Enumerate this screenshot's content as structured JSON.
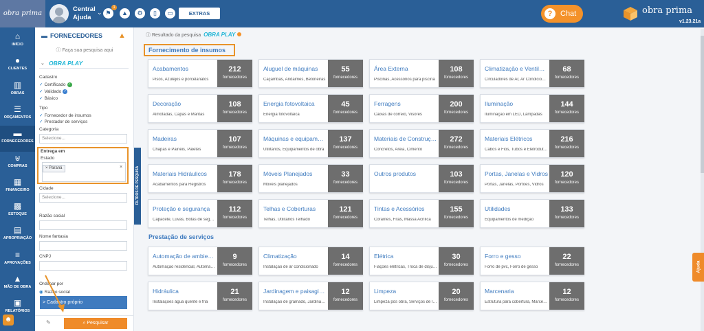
{
  "header": {
    "logo_text": "obra prima",
    "user_line1": "Central",
    "user_line2": "Ajuda",
    "notification_count": "1",
    "extras_label": "EXTRAS",
    "chat_label": "Chat",
    "brand": "obra prima",
    "version": "v1.23.21a"
  },
  "nav": [
    {
      "label": "INÍCIO",
      "icon": "home-icon",
      "glyph": "⌂"
    },
    {
      "label": "CLIENTES",
      "icon": "user-icon",
      "glyph": "●"
    },
    {
      "label": "OBRAS",
      "icon": "building-icon",
      "glyph": "▥"
    },
    {
      "label": "ORÇAMENTOS",
      "icon": "list-icon",
      "glyph": "☰"
    },
    {
      "label": "FORNECEDORES",
      "icon": "truck-icon",
      "glyph": "▬"
    },
    {
      "label": "COMPRAS",
      "icon": "cart-icon",
      "glyph": "⊎"
    },
    {
      "label": "FINANCEIRO",
      "icon": "calculator-icon",
      "glyph": "▦"
    },
    {
      "label": "ESTOQUE",
      "icon": "boxes-icon",
      "glyph": "▩"
    },
    {
      "label": "APROPRIAÇÃO",
      "icon": "clipboard-icon",
      "glyph": "▤"
    },
    {
      "label": "APROVAÇÕES",
      "icon": "checklist-icon",
      "glyph": "≡"
    },
    {
      "label": "MÃO DE OBRA",
      "icon": "workers-icon",
      "glyph": "▲"
    },
    {
      "label": "RELATÓRIOS",
      "icon": "report-icon",
      "glyph": "▣"
    }
  ],
  "filter": {
    "title": "FORNECEDORES",
    "search_hint": "Faça sua pesquisa aqui",
    "play_label": "OBRA PLAY",
    "cadastro_label": "Cadastro",
    "cadastro_options": [
      "Certificado",
      "Validado",
      "Básico"
    ],
    "tipo_label": "Tipo",
    "tipo_options": [
      "Fornecedor de insumos",
      "Prestador de serviços"
    ],
    "categoria_label": "Categoria",
    "categoria_placeholder": "Selecione...",
    "entrega_label": "Entrega em",
    "estado_label": "Estado",
    "estado_value": "× Paraná",
    "cidade_label": "Cidade",
    "cidade_placeholder": "Selecione...",
    "razao_label": "Razão social",
    "fantasia_label": "Nome fantasia",
    "cnpj_label": "CNPJ",
    "ordenar_label": "Ordenar por",
    "ordenar_option": "Razão social",
    "cadastro_proprio": "> Cadastro próprio",
    "tab_label": "FILTROS DE PESQUISA",
    "search_button": "Pesquisar"
  },
  "main": {
    "result_label": "Resultado da pesquisa",
    "play_label": "OBRA PLAY",
    "insumos_title": "Fornecimento de insumos",
    "servicos_title": "Prestação de serviços",
    "unit": "fornecedores",
    "insumos": [
      {
        "name": "Acabamentos",
        "desc": "Pisos, Azulejos e porcelanatos",
        "count": "212"
      },
      {
        "name": "Aluguel de máquinas",
        "desc": "Caçambas, Andaimes, Betoneiras",
        "count": "55"
      },
      {
        "name": "Área Externa",
        "desc": "Piscinas, Acessórios para piscina",
        "count": "108"
      },
      {
        "name": "Climatização e Ventilação",
        "desc": "Circuladores de Ar, Ar Condicionado",
        "count": "68"
      },
      {
        "name": "Decoração",
        "desc": "Almofadas, Capas e Mantas",
        "count": "108"
      },
      {
        "name": "Energia fotovoltaica",
        "desc": "Energia fotovoltaica",
        "count": "45"
      },
      {
        "name": "Ferragens",
        "desc": "Caixas de correio, Visores",
        "count": "200"
      },
      {
        "name": "Iluminação",
        "desc": "Iluminação em LED, Lâmpadas",
        "count": "144"
      },
      {
        "name": "Madeiras",
        "desc": "Chapas e Painéis, Paletes",
        "count": "107"
      },
      {
        "name": "Máquinas e equipamentos",
        "desc": "Utilitários, Equipamentos de obra",
        "count": "137"
      },
      {
        "name": "Materiais de Construção",
        "desc": "Concretos, Areia, Cimento",
        "count": "272"
      },
      {
        "name": "Materiais Elétricos",
        "desc": "Cabos e Fios, Tubos e Eletrodutos",
        "count": "216"
      },
      {
        "name": "Materiais Hidráulicos",
        "desc": "Acabamentos para Registros",
        "count": "178"
      },
      {
        "name": "Móveis Planejados",
        "desc": "Móveis planejados",
        "count": "33"
      },
      {
        "name": "Outros produtos",
        "desc": "",
        "count": "103"
      },
      {
        "name": "Portas, Janelas e Vidros",
        "desc": "Portas, Janelas, Portões, Vidros",
        "count": "120"
      },
      {
        "name": "Proteção e segurança",
        "desc": "Capacete, Luvas, Botas de segurança",
        "count": "112"
      },
      {
        "name": "Telhas e Coberturas",
        "desc": "Telhas, Utilitários Telhado",
        "count": "121"
      },
      {
        "name": "Tintas e Acessórios",
        "desc": "Corantes, Fitas, Massa Acrílica",
        "count": "155"
      },
      {
        "name": "Utilidades",
        "desc": "Equipamentos de medição",
        "count": "133"
      }
    ],
    "servicos": [
      {
        "name": "Automação de ambientes",
        "desc": "Automação residencial, Automação",
        "count": "9"
      },
      {
        "name": "Climatização",
        "desc": "Instalação de ar condicionado",
        "count": "14"
      },
      {
        "name": "Elétrica",
        "desc": "Fiações elétricas, Troca de disjuntor",
        "count": "30"
      },
      {
        "name": "Forro e gesso",
        "desc": "Forro de pvc, Forro de gesso",
        "count": "22"
      },
      {
        "name": "Hidráulica",
        "desc": "Instalações água quente e fria",
        "count": "21"
      },
      {
        "name": "Jardinagem e paisagismo",
        "desc": "Instalação de gramado, Jardinagem",
        "count": "12"
      },
      {
        "name": "Limpeza",
        "desc": "Limpeza pós obra, Serviços de limpeza",
        "count": "20"
      },
      {
        "name": "Marcenaria",
        "desc": "Estrutura para cobertura, Marcenaria",
        "count": "12"
      }
    ]
  },
  "help_tab": "Ajuda"
}
